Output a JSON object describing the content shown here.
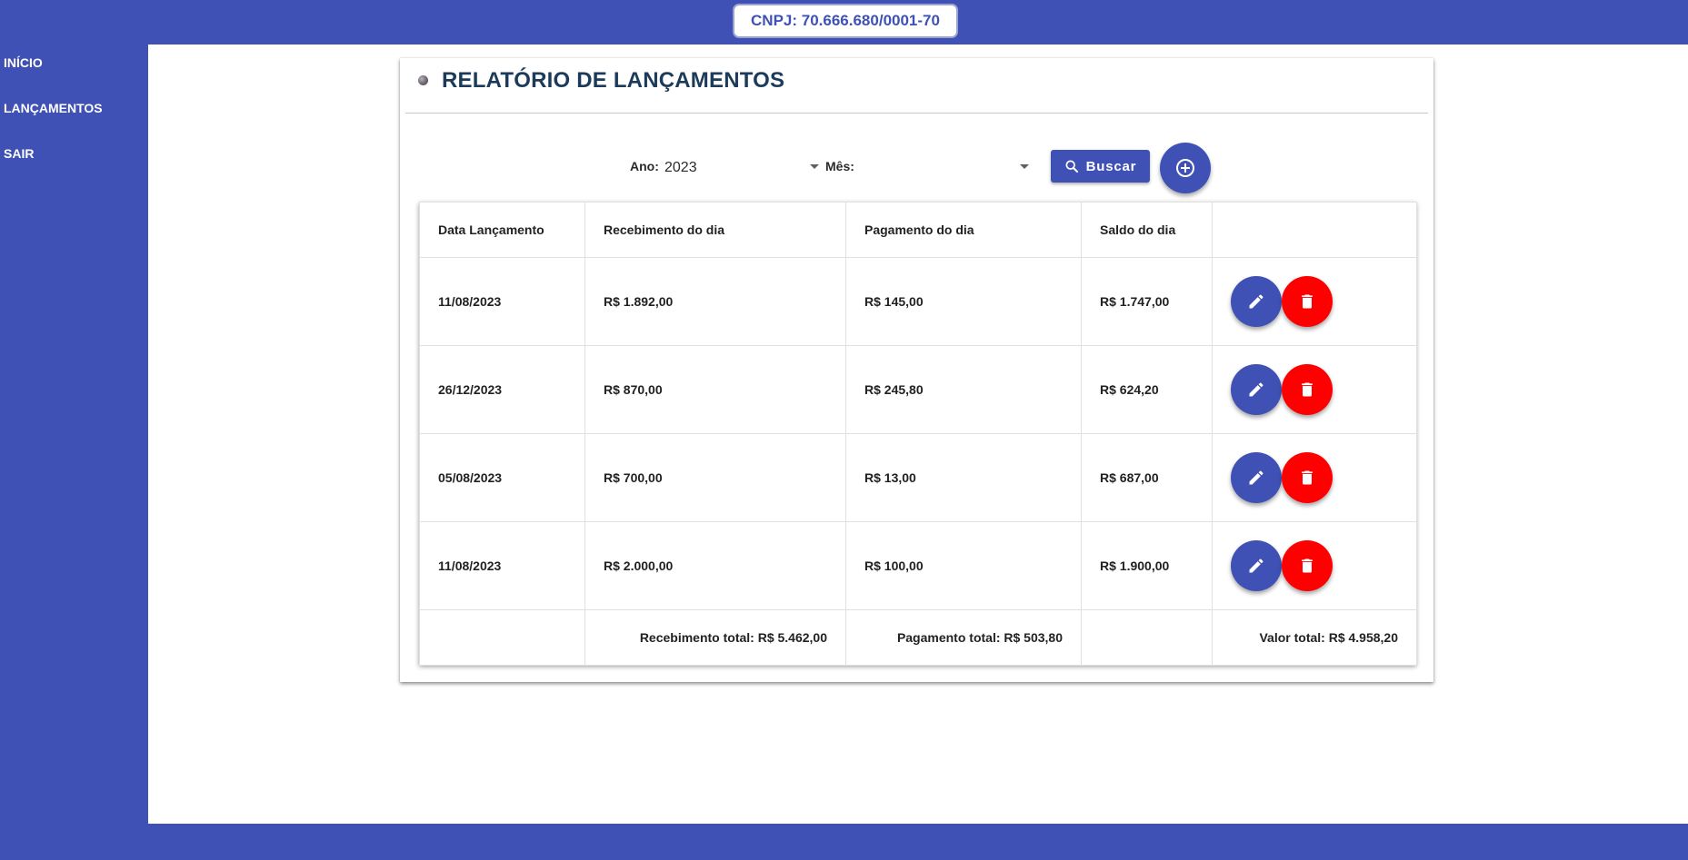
{
  "header": {
    "cnpj": "CNPJ: 70.666.680/0001-70"
  },
  "sidebar": {
    "items": [
      {
        "label": "INÍCIO"
      },
      {
        "label": "LANÇAMENTOS"
      },
      {
        "label": "SAIR"
      }
    ]
  },
  "page": {
    "title": "RELATÓRIO DE LANÇAMENTOS"
  },
  "filters": {
    "ano_label": "Ano:",
    "ano_value": "2023",
    "mes_label": "Mês:",
    "mes_value": "",
    "buscar_label": "Buscar"
  },
  "table": {
    "headers": [
      "Data Lançamento",
      "Recebimento do dia",
      "Pagamento do dia",
      "Saldo do dia",
      ""
    ],
    "rows": [
      {
        "data": "11/08/2023",
        "recebimento": "R$ 1.892,00",
        "pagamento": "R$ 145,00",
        "saldo": "R$ 1.747,00"
      },
      {
        "data": "26/12/2023",
        "recebimento": "R$ 870,00",
        "pagamento": "R$ 245,80",
        "saldo": "R$ 624,20"
      },
      {
        "data": "05/08/2023",
        "recebimento": "R$ 700,00",
        "pagamento": "R$ 13,00",
        "saldo": "R$ 687,00"
      },
      {
        "data": "11/08/2023",
        "recebimento": "R$ 2.000,00",
        "pagamento": "R$ 100,00",
        "saldo": "R$ 1.900,00"
      }
    ],
    "totals": {
      "recebimento": "Recebimento total: R$ 5.462,00",
      "pagamento": "Pagamento total: R$ 503,80",
      "valor": "Valor total: R$ 4.958,20"
    }
  },
  "icons": {
    "search": "search-icon",
    "add": "add-circle-icon",
    "edit": "pencil-icon",
    "delete": "trash-icon"
  },
  "colors": {
    "brand": "#3f51b5",
    "danger": "#ff0000",
    "title": "#1c3b5a"
  }
}
